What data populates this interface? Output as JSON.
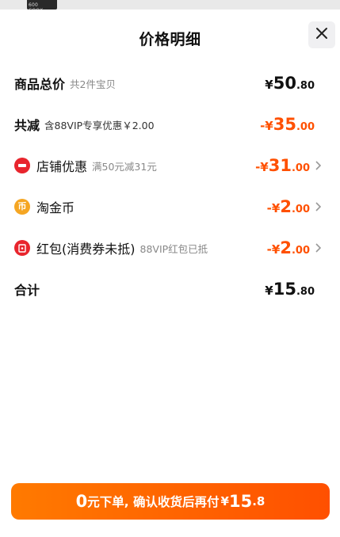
{
  "backdrop": {
    "thumb_text": "600\nCOOK"
  },
  "sheet": {
    "title": "价格明细"
  },
  "rows": {
    "total": {
      "label": "商品总价",
      "sub": "共2件宝贝",
      "currency": "¥",
      "int": "50",
      "dec": ".80"
    },
    "discount": {
      "label": "共减",
      "sub": "含88VIP专享优惠￥2.00",
      "currency": "-¥",
      "int": "35",
      "dec": ".00"
    },
    "store": {
      "label": "店铺优惠",
      "sub": "满50元减31元",
      "currency": "-¥",
      "int": "31",
      "dec": ".00"
    },
    "coins": {
      "label": "淘金币",
      "icon_glyph": "币",
      "currency": "-¥",
      "int": "2",
      "dec": ".00"
    },
    "redpacket": {
      "label": "红包(消费券未抵)",
      "sub": "88VIP红包已抵",
      "currency": "-¥",
      "int": "2",
      "dec": ".00"
    },
    "sum": {
      "label": "合计",
      "currency": "¥",
      "int": "15",
      "dec": ".80"
    }
  },
  "cta": {
    "zero": "0",
    "text": "元下单, 确认收货后再付",
    "currency": "¥",
    "int": "15",
    "dec": ".8"
  },
  "colors": {
    "accent": "#ff5000",
    "red_icon": "#e8252d",
    "coin_icon": "#f5a623",
    "text_muted": "#888888"
  }
}
